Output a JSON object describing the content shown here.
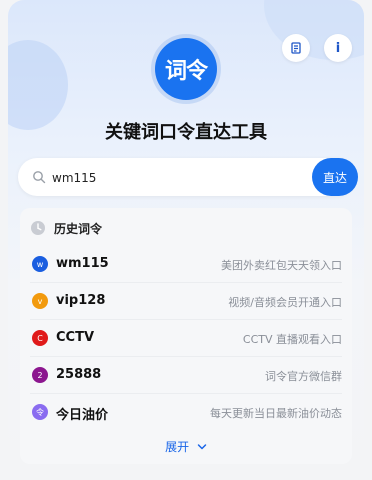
{
  "app": {
    "logo_text": "词令",
    "title": "关键词口令直达工具",
    "doc_icon": "document-icon",
    "info_label": "i"
  },
  "search": {
    "value": "wm115",
    "button_label": "直达",
    "icon": "search-icon"
  },
  "history": {
    "heading": "历史词令",
    "icon": "clock-icon",
    "items": [
      {
        "badge": "w",
        "color": "#1a5ee0",
        "keyword": "wm115",
        "desc": "美团外卖红包天天领入口"
      },
      {
        "badge": "v",
        "color": "#f29a0e",
        "keyword": "vip128",
        "desc": "视频/音频会员开通入口"
      },
      {
        "badge": "C",
        "color": "#e01a1a",
        "keyword": "CCTV",
        "desc": "CCTV 直播观看入口"
      },
      {
        "badge": "2",
        "color": "#8c168f",
        "keyword": "25888",
        "desc": "词令官方微信群"
      },
      {
        "badge": "令",
        "color": "#8a6cf0",
        "keyword": "今日油价",
        "desc": "每天更新当日最新油价动态"
      }
    ],
    "expand_label": "展开"
  },
  "colors": {
    "accent": "#1a73f0",
    "link": "#1a66e8"
  }
}
